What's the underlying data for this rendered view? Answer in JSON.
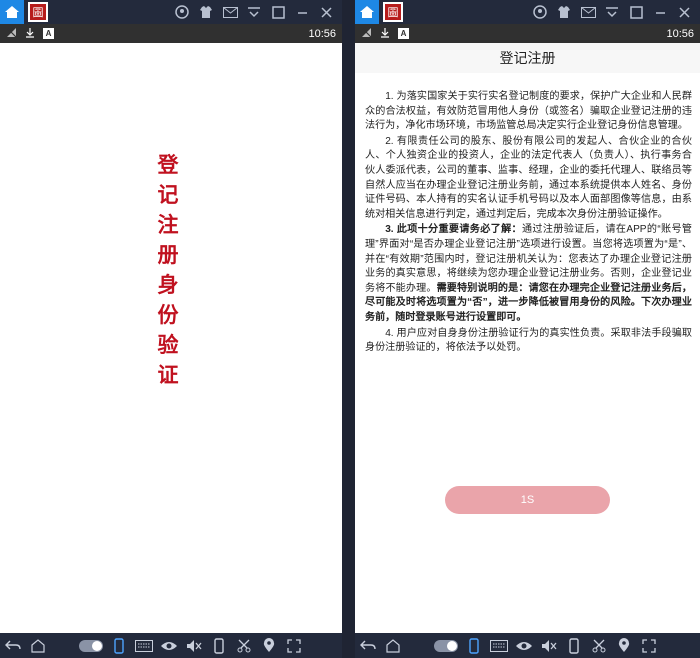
{
  "status_bar": {
    "time": "10:56"
  },
  "left_pane": {
    "splash_title": "登记注册身份验证"
  },
  "right_pane": {
    "header_title": "登记注册",
    "paragraphs": {
      "p1": "1. 为落实国家关于实行实名登记制度的要求，保护广大企业和人民群众的合法权益，有效防范冒用他人身份（或签名）骗取企业登记注册的违法行为，净化市场环境，市场监管总局决定实行企业登记身份信息管理。",
      "p2": "2. 有限责任公司的股东、股份有限公司的发起人、合伙企业的合伙人、个人独资企业的投资人，企业的法定代表人（负责人）、执行事务合伙人委派代表，公司的董事、监事、经理，企业的委托代理人、联络员等自然人应当在办理企业登记注册业务前，通过本系统提供本人姓名、身份证件号码、本人持有的实名认证手机号码以及本人面部图像等信息，由系统对相关信息进行判定，通过判定后，完成本次身份注册验证操作。",
      "p3_bold_lead": "3. 此项十分重要请务必了解：",
      "p3_text": "通过注册验证后，请在APP的“账号管理”界面对“是否办理企业登记注册”选项进行设置。当您将选项置为“是”、并在“有效期”范围内时，登记注册机关认为：您表达了办理企业登记注册业务的真实意思，将继续为您办理企业登记注册业务。否则，企业登记业务将不能办理。",
      "p3_bold_tail": "需要特别说明的是：请您在办理完企业登记注册业务后，尽可能及时将选项置为“否”，进一步降低被冒用身份的风险。下次办理业务前，随时登录账号进行设置即可。",
      "p4": "4. 用户应对自身身份注册验证行为的真实性负责。采取非法手段骗取身份注册验证的，将依法予以处罚。"
    },
    "countdown_label": "1S"
  },
  "icons": {
    "emulator_top": [
      "home-icon",
      "app-badge-icon",
      "user-icon",
      "shirt-icon",
      "mail-icon",
      "menu-icon",
      "restore-icon",
      "minimize-icon",
      "close-icon"
    ],
    "status_left": [
      "signal-off-icon",
      "download-icon",
      "a-box-icon"
    ],
    "nav": [
      "back-icon",
      "home-outline-icon",
      "toggle-icon",
      "portrait-icon",
      "keyboard-icon",
      "eye-icon",
      "mute-icon",
      "phone-icon",
      "cut-icon",
      "location-icon",
      "fullscreen-icon"
    ]
  },
  "colors": {
    "accent_red": "#c0111f",
    "button_pink": "#eaa4aa",
    "emulator_bar": "#232a3c",
    "status_bar": "#303030"
  }
}
